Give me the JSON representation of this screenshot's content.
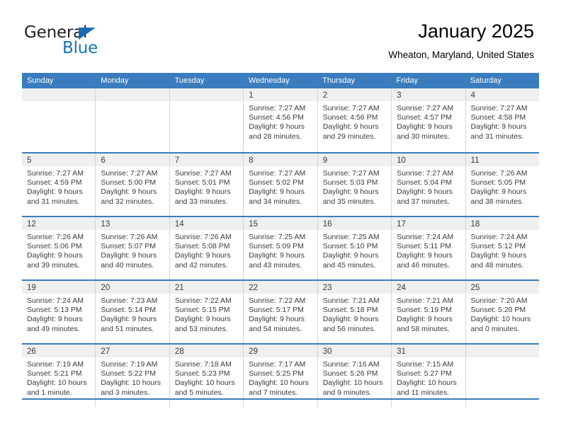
{
  "brand": {
    "name_part1": "General",
    "name_part2": "Blue",
    "accent_color": "#1673bd",
    "triangle_icon": "triangle-icon"
  },
  "header": {
    "month_title": "January 2025",
    "location": "Wheaton, Maryland, United States"
  },
  "theme": {
    "header_blue": "#3a7cbe",
    "daynum_bg": "#efefef",
    "cell_border": "#d4d4d4",
    "text": "#3b3b3b"
  },
  "weekdays": [
    "Sunday",
    "Monday",
    "Tuesday",
    "Wednesday",
    "Thursday",
    "Friday",
    "Saturday"
  ],
  "calendar": {
    "weeks": [
      [
        {
          "day": "",
          "empty": true,
          "lines": []
        },
        {
          "day": "",
          "empty": true,
          "lines": []
        },
        {
          "day": "",
          "empty": true,
          "lines": []
        },
        {
          "day": "1",
          "empty": false,
          "lines": [
            "Sunrise: 7:27 AM",
            "Sunset: 4:56 PM",
            "Daylight: 9 hours",
            "and 28 minutes."
          ]
        },
        {
          "day": "2",
          "empty": false,
          "lines": [
            "Sunrise: 7:27 AM",
            "Sunset: 4:56 PM",
            "Daylight: 9 hours",
            "and 29 minutes."
          ]
        },
        {
          "day": "3",
          "empty": false,
          "lines": [
            "Sunrise: 7:27 AM",
            "Sunset: 4:57 PM",
            "Daylight: 9 hours",
            "and 30 minutes."
          ]
        },
        {
          "day": "4",
          "empty": false,
          "lines": [
            "Sunrise: 7:27 AM",
            "Sunset: 4:58 PM",
            "Daylight: 9 hours",
            "and 31 minutes."
          ]
        }
      ],
      [
        {
          "day": "5",
          "empty": false,
          "lines": [
            "Sunrise: 7:27 AM",
            "Sunset: 4:59 PM",
            "Daylight: 9 hours",
            "and 31 minutes."
          ]
        },
        {
          "day": "6",
          "empty": false,
          "lines": [
            "Sunrise: 7:27 AM",
            "Sunset: 5:00 PM",
            "Daylight: 9 hours",
            "and 32 minutes."
          ]
        },
        {
          "day": "7",
          "empty": false,
          "lines": [
            "Sunrise: 7:27 AM",
            "Sunset: 5:01 PM",
            "Daylight: 9 hours",
            "and 33 minutes."
          ]
        },
        {
          "day": "8",
          "empty": false,
          "lines": [
            "Sunrise: 7:27 AM",
            "Sunset: 5:02 PM",
            "Daylight: 9 hours",
            "and 34 minutes."
          ]
        },
        {
          "day": "9",
          "empty": false,
          "lines": [
            "Sunrise: 7:27 AM",
            "Sunset: 5:03 PM",
            "Daylight: 9 hours",
            "and 35 minutes."
          ]
        },
        {
          "day": "10",
          "empty": false,
          "lines": [
            "Sunrise: 7:27 AM",
            "Sunset: 5:04 PM",
            "Daylight: 9 hours",
            "and 37 minutes."
          ]
        },
        {
          "day": "11",
          "empty": false,
          "lines": [
            "Sunrise: 7:26 AM",
            "Sunset: 5:05 PM",
            "Daylight: 9 hours",
            "and 38 minutes."
          ]
        }
      ],
      [
        {
          "day": "12",
          "empty": false,
          "lines": [
            "Sunrise: 7:26 AM",
            "Sunset: 5:06 PM",
            "Daylight: 9 hours",
            "and 39 minutes."
          ]
        },
        {
          "day": "13",
          "empty": false,
          "lines": [
            "Sunrise: 7:26 AM",
            "Sunset: 5:07 PM",
            "Daylight: 9 hours",
            "and 40 minutes."
          ]
        },
        {
          "day": "14",
          "empty": false,
          "lines": [
            "Sunrise: 7:26 AM",
            "Sunset: 5:08 PM",
            "Daylight: 9 hours",
            "and 42 minutes."
          ]
        },
        {
          "day": "15",
          "empty": false,
          "lines": [
            "Sunrise: 7:25 AM",
            "Sunset: 5:09 PM",
            "Daylight: 9 hours",
            "and 43 minutes."
          ]
        },
        {
          "day": "16",
          "empty": false,
          "lines": [
            "Sunrise: 7:25 AM",
            "Sunset: 5:10 PM",
            "Daylight: 9 hours",
            "and 45 minutes."
          ]
        },
        {
          "day": "17",
          "empty": false,
          "lines": [
            "Sunrise: 7:24 AM",
            "Sunset: 5:11 PM",
            "Daylight: 9 hours",
            "and 46 minutes."
          ]
        },
        {
          "day": "18",
          "empty": false,
          "lines": [
            "Sunrise: 7:24 AM",
            "Sunset: 5:12 PM",
            "Daylight: 9 hours",
            "and 48 minutes."
          ]
        }
      ],
      [
        {
          "day": "19",
          "empty": false,
          "lines": [
            "Sunrise: 7:24 AM",
            "Sunset: 5:13 PM",
            "Daylight: 9 hours",
            "and 49 minutes."
          ]
        },
        {
          "day": "20",
          "empty": false,
          "lines": [
            "Sunrise: 7:23 AM",
            "Sunset: 5:14 PM",
            "Daylight: 9 hours",
            "and 51 minutes."
          ]
        },
        {
          "day": "21",
          "empty": false,
          "lines": [
            "Sunrise: 7:22 AM",
            "Sunset: 5:15 PM",
            "Daylight: 9 hours",
            "and 53 minutes."
          ]
        },
        {
          "day": "22",
          "empty": false,
          "lines": [
            "Sunrise: 7:22 AM",
            "Sunset: 5:17 PM",
            "Daylight: 9 hours",
            "and 54 minutes."
          ]
        },
        {
          "day": "23",
          "empty": false,
          "lines": [
            "Sunrise: 7:21 AM",
            "Sunset: 5:18 PM",
            "Daylight: 9 hours",
            "and 56 minutes."
          ]
        },
        {
          "day": "24",
          "empty": false,
          "lines": [
            "Sunrise: 7:21 AM",
            "Sunset: 5:19 PM",
            "Daylight: 9 hours",
            "and 58 minutes."
          ]
        },
        {
          "day": "25",
          "empty": false,
          "lines": [
            "Sunrise: 7:20 AM",
            "Sunset: 5:20 PM",
            "Daylight: 10 hours",
            "and 0 minutes."
          ]
        }
      ],
      [
        {
          "day": "26",
          "empty": false,
          "lines": [
            "Sunrise: 7:19 AM",
            "Sunset: 5:21 PM",
            "Daylight: 10 hours",
            "and 1 minute."
          ]
        },
        {
          "day": "27",
          "empty": false,
          "lines": [
            "Sunrise: 7:19 AM",
            "Sunset: 5:22 PM",
            "Daylight: 10 hours",
            "and 3 minutes."
          ]
        },
        {
          "day": "28",
          "empty": false,
          "lines": [
            "Sunrise: 7:18 AM",
            "Sunset: 5:23 PM",
            "Daylight: 10 hours",
            "and 5 minutes."
          ]
        },
        {
          "day": "29",
          "empty": false,
          "lines": [
            "Sunrise: 7:17 AM",
            "Sunset: 5:25 PM",
            "Daylight: 10 hours",
            "and 7 minutes."
          ]
        },
        {
          "day": "30",
          "empty": false,
          "lines": [
            "Sunrise: 7:16 AM",
            "Sunset: 5:26 PM",
            "Daylight: 10 hours",
            "and 9 minutes."
          ]
        },
        {
          "day": "31",
          "empty": false,
          "lines": [
            "Sunrise: 7:15 AM",
            "Sunset: 5:27 PM",
            "Daylight: 10 hours",
            "and 11 minutes."
          ]
        },
        {
          "day": "",
          "empty": true,
          "lines": []
        }
      ]
    ]
  }
}
